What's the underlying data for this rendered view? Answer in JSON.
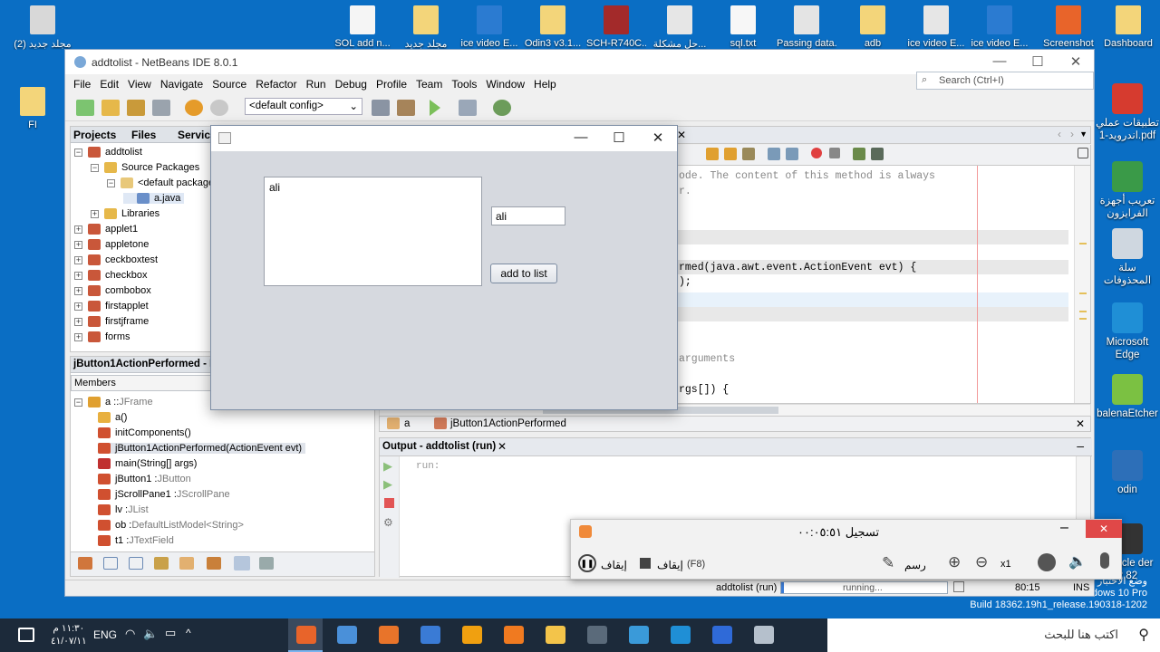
{
  "desktop": {
    "top_icons": [
      {
        "label": "مجلد جديد (2)",
        "color": "#d8d8d8"
      },
      {
        "label": "SOL add n...",
        "color": "#f5f5f5"
      },
      {
        "label": "مجلد جديد",
        "color": "#f3d57a"
      },
      {
        "label": "ice video E...",
        "color": "#2b7bd1"
      },
      {
        "label": "Odin3 v3.1...",
        "color": "#f3d57a"
      },
      {
        "label": "SCH-R740C...",
        "color": "#a32a2a"
      },
      {
        "label": "حل مشكلة...",
        "color": "#e6e6e6"
      },
      {
        "label": "sql.txt",
        "color": "#f7f7f7"
      },
      {
        "label": "Passing data...",
        "color": "#e4e4e4"
      },
      {
        "label": "adb",
        "color": "#f3d57a"
      },
      {
        "label": "ice video E...",
        "color": "#e6e6e6"
      },
      {
        "label": "ice video E...",
        "color": "#2b7bd1"
      },
      {
        "label": "Screenshot",
        "color": "#e8642a"
      },
      {
        "label": "Dashboard",
        "color": "#f3d57a"
      }
    ],
    "left_icon": {
      "label": "FI",
      "color": "#f3d57a"
    },
    "right_icons": [
      {
        "label": "تطبيقات عملي اندرويد-1.pdf",
        "color": "#d63b2f"
      },
      {
        "label": "تعريب أجهزة الفرايزون",
        "color": "#3a9a48"
      },
      {
        "label": "سلة المحذوفات",
        "color": "#cfd7e0"
      },
      {
        "label": "Microsoft Edge",
        "color": "#1f8fd6"
      },
      {
        "label": "balenaEtcher",
        "color": "#7bc142"
      },
      {
        "label": "odin",
        "color": "#2d6fb8"
      },
      {
        "label": "Miracle der 2.82",
        "color": "#333333"
      }
    ],
    "edge_text": [
      "وضع الاختبار",
      "Windows 10 Pro",
      "Build 18362.19h1_release.190318-1202"
    ]
  },
  "netbeans": {
    "title": "addtolist - NetBeans IDE 8.0.1",
    "menu": [
      "File",
      "Edit",
      "View",
      "Navigate",
      "Source",
      "Refactor",
      "Run",
      "Debug",
      "Profile",
      "Team",
      "Tools",
      "Window",
      "Help"
    ],
    "config": "<default config>",
    "search_placeholder": "Search (Ctrl+I)",
    "tabs": {
      "projects": "Projects",
      "files": "Files",
      "services": "Service"
    },
    "tree": [
      {
        "label": "addtolist",
        "level": 0,
        "kind": "project",
        "exp": "−"
      },
      {
        "label": "Source Packages",
        "level": 1,
        "kind": "folder",
        "exp": "−"
      },
      {
        "label": "<default package",
        "level": 2,
        "kind": "package",
        "exp": "−"
      },
      {
        "label": "a.java",
        "level": 3,
        "kind": "java",
        "exp": ""
      },
      {
        "label": "Libraries",
        "level": 1,
        "kind": "folder",
        "exp": "+"
      },
      {
        "label": "applet1",
        "level": 0,
        "kind": "project",
        "exp": "+"
      },
      {
        "label": "appletone",
        "level": 0,
        "kind": "project",
        "exp": "+"
      },
      {
        "label": "ceckboxtest",
        "level": 0,
        "kind": "project",
        "exp": "+"
      },
      {
        "label": "checkbox",
        "level": 0,
        "kind": "project",
        "exp": "+"
      },
      {
        "label": "combobox",
        "level": 0,
        "kind": "project",
        "exp": "+"
      },
      {
        "label": "firstapplet",
        "level": 0,
        "kind": "project",
        "exp": "+"
      },
      {
        "label": "firstjframe",
        "level": 0,
        "kind": "project",
        "exp": "+"
      },
      {
        "label": "forms",
        "level": 0,
        "kind": "project",
        "exp": "+"
      }
    ],
    "navigator_title": "jButton1ActionPerformed - Nav",
    "members_label": "Members",
    "members": [
      {
        "name": "a :: ",
        "type": "JFrame",
        "level": 0,
        "color": "#e0a030"
      },
      {
        "name": "a()",
        "type": "",
        "level": 1,
        "color": "#e8b040"
      },
      {
        "name": "initComponents()",
        "type": "",
        "level": 1,
        "color": "#d05030"
      },
      {
        "name": "jButton1ActionPerformed(ActionEvent evt)",
        "type": "",
        "level": 1,
        "color": "#d05030",
        "selected": true
      },
      {
        "name": "main(String[] args)",
        "type": "",
        "level": 1,
        "color": "#c03030"
      },
      {
        "name": "jButton1 : ",
        "type": "JButton",
        "level": 1,
        "color": "#d05030"
      },
      {
        "name": "jScrollPane1 : ",
        "type": "JScrollPane",
        "level": 1,
        "color": "#d05030"
      },
      {
        "name": "lv : ",
        "type": "JList",
        "level": 1,
        "color": "#d05030"
      },
      {
        "name": "ob : ",
        "type": "DefaultListModel<String>",
        "level": 1,
        "color": "#d05030"
      },
      {
        "name": "t1 : ",
        "type": "JTextField",
        "level": 1,
        "color": "#d05030"
      }
    ],
    "code_lines": [
      {
        "text": "ode. The content of this method is always",
        "color": "#888888"
      },
      {
        "text": "r.",
        "color": "#888888"
      },
      {
        "text": "rmed(java.awt.event.ActionEvent evt) {",
        "color": "#000000"
      },
      {
        "text": ");",
        "color": "#000000"
      },
      {
        "text": "arguments",
        "color": "#888888"
      },
      {
        "text": "rgs[]) {",
        "color": "#000000"
      }
    ],
    "breadcrumb": [
      "a",
      "jButton1ActionPerformed"
    ],
    "output_title": "Output - addtolist (run)",
    "output_text": "run:",
    "status": {
      "project": "addtolist (run)",
      "state": "running...",
      "position": "80:15",
      "mode": "INS"
    }
  },
  "jframe": {
    "list_items": [
      "ali"
    ],
    "text_value": "ali",
    "button_label": "add to list"
  },
  "recorder": {
    "title": "تسجيل ٠٠:٠٥:٥١",
    "pause_label": "إيقاف",
    "stop_label": "إيقاف",
    "stop_shortcut": "(F8)",
    "draw_label": "رسم",
    "zoom_level": "x1"
  },
  "taskbar": {
    "search_placeholder": "اكتب هنا للبحث",
    "lang": "ENG",
    "time": "١١:٣٠ م",
    "date": "٤١/٠٧/١١"
  }
}
